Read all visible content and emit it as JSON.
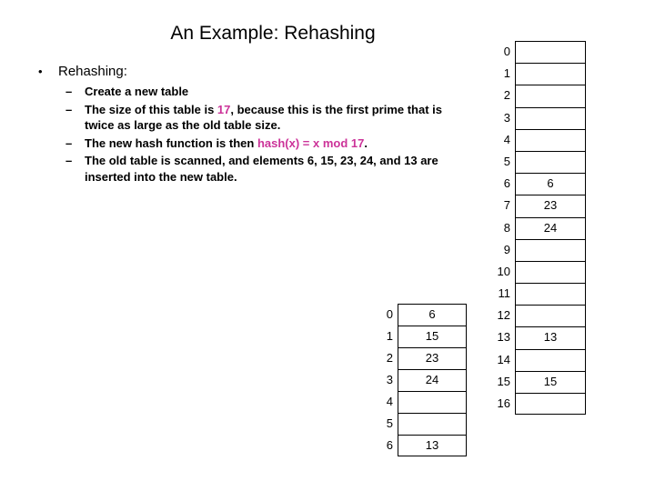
{
  "slide": {
    "title": "An Example: Rehashing",
    "accent_color": "#CC3399",
    "background_color": "#FFFFFF",
    "text_color": "#000000"
  },
  "body": {
    "bullet1": {
      "marker": "•",
      "text": "Rehashing:"
    },
    "sub_bullets": [
      {
        "marker": "–",
        "segments": [
          {
            "text": "Create a new table",
            "highlight": false
          }
        ]
      },
      {
        "marker": "–",
        "segments": [
          {
            "text": "The size of this table is ",
            "highlight": false
          },
          {
            "text": "17",
            "highlight": true
          },
          {
            "text": ", because this is the first prime that is twice as large as the old table size.",
            "highlight": false
          }
        ]
      },
      {
        "marker": "–",
        "segments": [
          {
            "text": "The new hash function is then ",
            "highlight": false
          },
          {
            "text": "hash(x) = x mod 17",
            "highlight": true
          },
          {
            "text": ".",
            "highlight": false
          }
        ]
      },
      {
        "marker": "–",
        "segments": [
          {
            "text": "The old table is scanned, and elements 6, 15, 23, 24, and 13 are inserted into the new table.",
            "highlight": false
          }
        ]
      }
    ]
  },
  "tables": {
    "old_table": {
      "name": "old-hash-table",
      "size": 7,
      "rows": [
        {
          "index": "0",
          "value": "6"
        },
        {
          "index": "1",
          "value": "15"
        },
        {
          "index": "2",
          "value": "23"
        },
        {
          "index": "3",
          "value": "24"
        },
        {
          "index": "4",
          "value": ""
        },
        {
          "index": "5",
          "value": ""
        },
        {
          "index": "6",
          "value": "13"
        }
      ]
    },
    "new_table": {
      "name": "new-hash-table",
      "size": 17,
      "rows": [
        {
          "index": "0",
          "value": ""
        },
        {
          "index": "1",
          "value": ""
        },
        {
          "index": "2",
          "value": ""
        },
        {
          "index": "3",
          "value": ""
        },
        {
          "index": "4",
          "value": ""
        },
        {
          "index": "5",
          "value": ""
        },
        {
          "index": "6",
          "value": "6"
        },
        {
          "index": "7",
          "value": "23"
        },
        {
          "index": "8",
          "value": "24"
        },
        {
          "index": "9",
          "value": ""
        },
        {
          "index": "10",
          "value": ""
        },
        {
          "index": "11",
          "value": ""
        },
        {
          "index": "12",
          "value": ""
        },
        {
          "index": "13",
          "value": "13"
        },
        {
          "index": "14",
          "value": ""
        },
        {
          "index": "15",
          "value": "15"
        },
        {
          "index": "16",
          "value": ""
        }
      ]
    }
  }
}
